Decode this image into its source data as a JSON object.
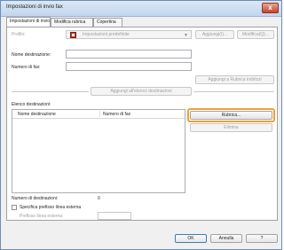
{
  "window": {
    "title": "Impostazioni di invio fax",
    "close_glyph": "x"
  },
  "tabs": [
    {
      "label": "Impostazioni di invio",
      "active": true
    },
    {
      "label": "Modifica rubrica",
      "active": false
    },
    {
      "label": "Copertina",
      "active": false
    }
  ],
  "profile": {
    "label": "Profilo:",
    "value": "Impostazioni predefinite",
    "add_button": "Aggiungi(I)...",
    "edit_button": "Modifica(Q)..."
  },
  "destination": {
    "name_label": "Nome destinazione:",
    "fax_label": "Numero di fax:",
    "name_value": "",
    "fax_value": "",
    "add_to_addressbook_button": "Aggiungi a Rubrica indirizzi",
    "add_to_list_button": "Aggiungi all'elenco destinazioni"
  },
  "list": {
    "label": "Elenco destinazioni:",
    "columns": [
      "Nome destinazione",
      "Numero di fax"
    ],
    "rows": []
  },
  "side_buttons": {
    "addressbook": "Rubrica...",
    "delete": "Elimina"
  },
  "count": {
    "label": "Numero di destinazioni:",
    "value": "0"
  },
  "prefix": {
    "checkbox_label": "Specifica prefisso linea esterna",
    "field_label": "Prefisso linea esterna:",
    "checked": false,
    "value": ""
  },
  "footer": {
    "ok": "OK",
    "cancel": "Annulla",
    "help": "?"
  },
  "colors": {
    "highlight": "#f0a030",
    "title_bar": "#c3d6ed"
  }
}
